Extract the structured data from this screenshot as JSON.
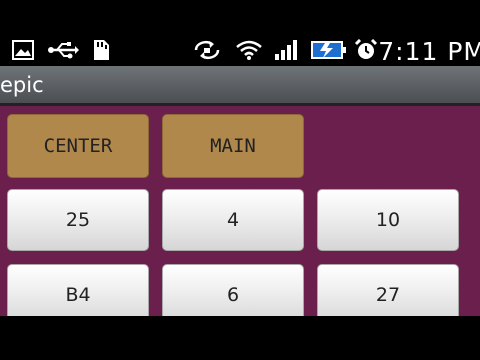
{
  "status_bar": {
    "time": "7:11 PM",
    "left_icons": [
      "image-icon",
      "usb-icon",
      "sd-card-icon"
    ],
    "right_icons": [
      "sync-icon",
      "wifi-icon",
      "signal-icon",
      "battery-charging-icon",
      "alarm-icon"
    ]
  },
  "app": {
    "title": "epic"
  },
  "buttons": {
    "row1": [
      "CENTER",
      "MAIN"
    ],
    "row2": [
      "25",
      "4",
      "10"
    ],
    "row3": [
      "B4",
      "6",
      "27"
    ]
  },
  "colors": {
    "background": "#6b1f4d",
    "gold_button": "#b0884c",
    "gray_button": "#e8e8e8",
    "title_bar": "#5a5e62"
  }
}
